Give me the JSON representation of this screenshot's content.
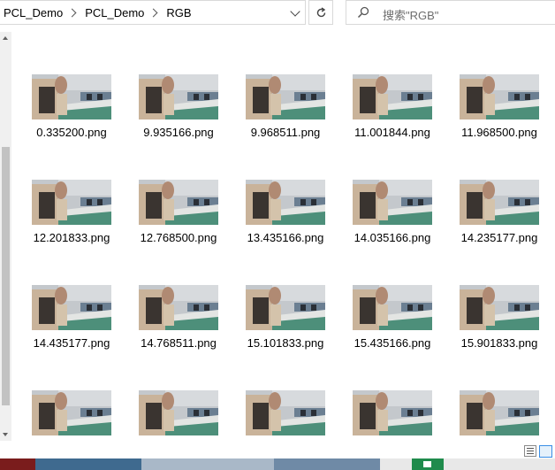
{
  "breadcrumb": [
    "PCL_Demo",
    "PCL_Demo",
    "RGB"
  ],
  "search": {
    "placeholder": "搜索\"RGB\""
  },
  "icons": {
    "address_dropdown": "chevron-down-icon",
    "refresh": "refresh-icon",
    "search": "search-icon",
    "scroll_up": "scroll-up-icon",
    "scroll_down": "scroll-down-icon",
    "details_view": "details-view-icon",
    "tiles_view": "large-icons-view-icon"
  },
  "files": [
    "0.335200.png",
    "9.935166.png",
    "9.968511.png",
    "11.001844.png",
    "11.968500.png",
    "12.201833.png",
    "12.768500.png",
    "13.435166.png",
    "14.035166.png",
    "14.235177.png",
    "14.435177.png",
    "14.768511.png",
    "15.101833.png",
    "15.435166.png",
    "15.901833.png",
    "",
    "",
    "",
    "",
    ""
  ],
  "colors": {
    "accent": "#3a8ee6",
    "border": "#d9d9d9"
  }
}
